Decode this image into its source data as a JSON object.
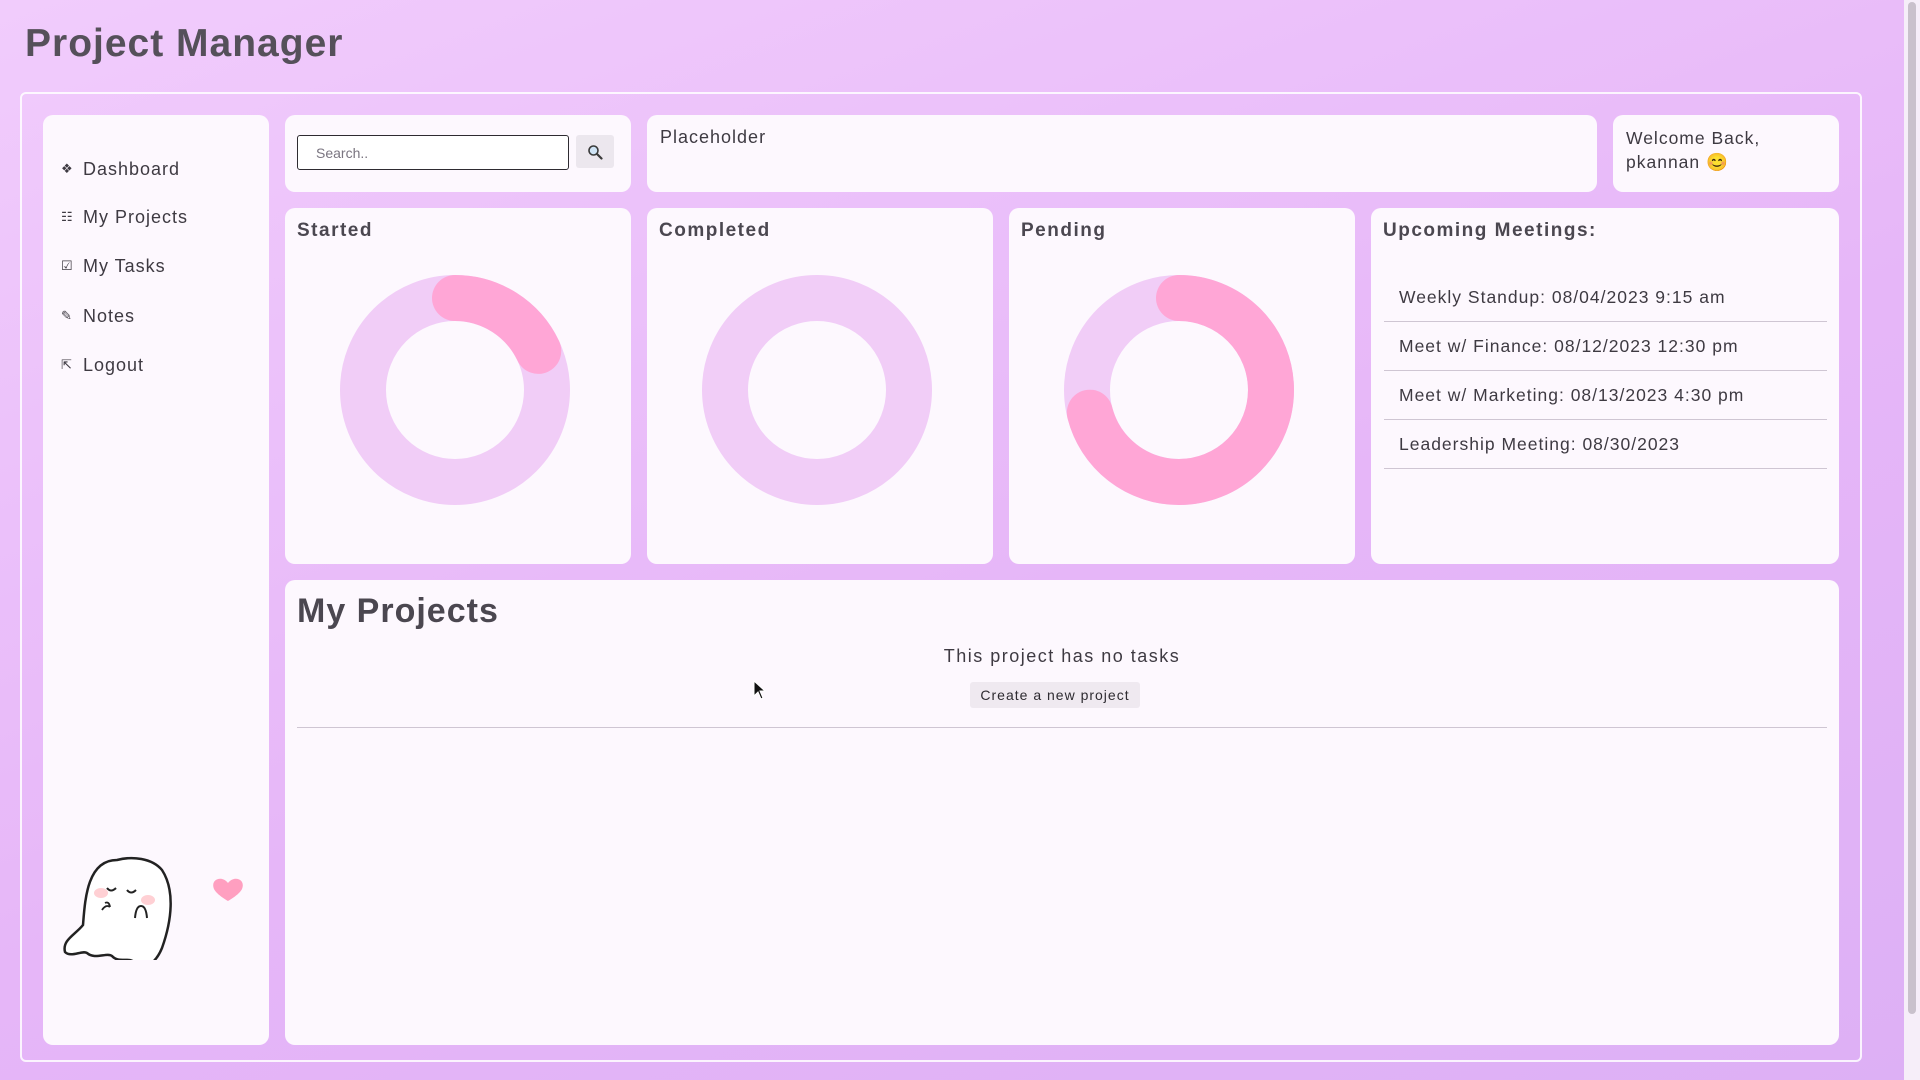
{
  "app": {
    "title": "Project Manager"
  },
  "sidebar": {
    "items": [
      {
        "label": "Dashboard",
        "icon": "❖"
      },
      {
        "label": "My Projects",
        "icon": "☷"
      },
      {
        "label": "My Tasks",
        "icon": "☑"
      },
      {
        "label": "Notes",
        "icon": "✎"
      },
      {
        "label": "Logout",
        "icon": "⇱"
      }
    ]
  },
  "search": {
    "placeholder": "Search..",
    "value": ""
  },
  "placeholder_panel": {
    "text": "Placeholder"
  },
  "welcome": {
    "line1": "Welcome Back,",
    "line2": "pkannan 😊"
  },
  "stats": [
    {
      "label": "Started",
      "fraction": 0.18
    },
    {
      "label": "Completed",
      "fraction": 0
    },
    {
      "label": "Pending",
      "fraction": 0.71
    }
  ],
  "meetings": {
    "title": "Upcoming Meetings:",
    "items": [
      "Weekly Standup: 08/04/2023 9:15 am",
      "Meet w/ Finance: 08/12/2023 12:30 pm",
      "Meet w/ Marketing: 08/13/2023 4:30 pm",
      "Leadership Meeting: 08/30/2023"
    ]
  },
  "projects": {
    "title": "My Projects",
    "empty_message": "This project has no tasks",
    "create_label": "Create a new project"
  },
  "colors": {
    "ring_track": "#f1cdf7",
    "ring_fill": "#ffa6d6",
    "card": "#fdf8fe",
    "heart": "#ff9fc0"
  }
}
